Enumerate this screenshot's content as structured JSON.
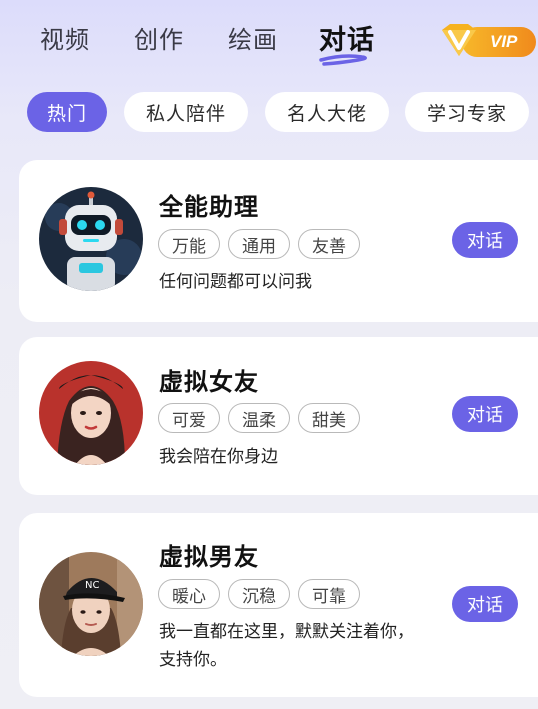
{
  "nav": {
    "tabs": [
      {
        "label": "视频"
      },
      {
        "label": "创作"
      },
      {
        "label": "绘画"
      },
      {
        "label": "对话",
        "active": true
      }
    ],
    "vip_label": "VIP"
  },
  "categories": [
    {
      "label": "热门",
      "active": true
    },
    {
      "label": "私人陪伴"
    },
    {
      "label": "名人大佬"
    },
    {
      "label": "学习专家"
    }
  ],
  "cards": [
    {
      "title": "全能助理",
      "tags": [
        "万能",
        "通用",
        "友善"
      ],
      "desc": "任何问题都可以问我",
      "button": "对话",
      "avatar": "robot-avatar"
    },
    {
      "title": "虚拟女友",
      "tags": [
        "可爱",
        "温柔",
        "甜美"
      ],
      "desc": "我会陪在你身边",
      "button": "对话",
      "avatar": "girl-avatar"
    },
    {
      "title": "虚拟男友",
      "tags": [
        "暖心",
        "沉稳",
        "可靠"
      ],
      "desc": "我一直都在这里，默默关注着你，支持你。",
      "button": "对话",
      "avatar": "boy-avatar"
    }
  ],
  "colors": {
    "accent": "#6b63e6",
    "vip_orange": "#f08a1c",
    "card_bg": "#ffffff"
  }
}
